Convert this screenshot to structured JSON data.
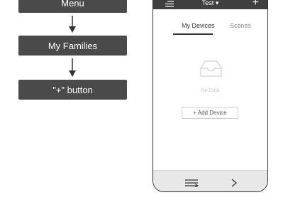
{
  "flow": {
    "steps": [
      "Menu",
      "My Families",
      "\"+\" button"
    ]
  },
  "app": {
    "family_title": "Test ▾",
    "add_label": "+",
    "tabs": [
      "My Devices",
      "Scenes"
    ],
    "empty_state": "No Data",
    "add_device_label": "+ Add Device",
    "next_label": ">"
  },
  "icons": [
    "menu-icon",
    "plus-icon",
    "inbox-icon",
    "queue-icon",
    "chevron-right-icon",
    "arrow-down-icon"
  ],
  "colors": {
    "step_box": "#4a4a4a",
    "header": "#3f3f3f",
    "bottom_bar": "#e8e8e8"
  }
}
